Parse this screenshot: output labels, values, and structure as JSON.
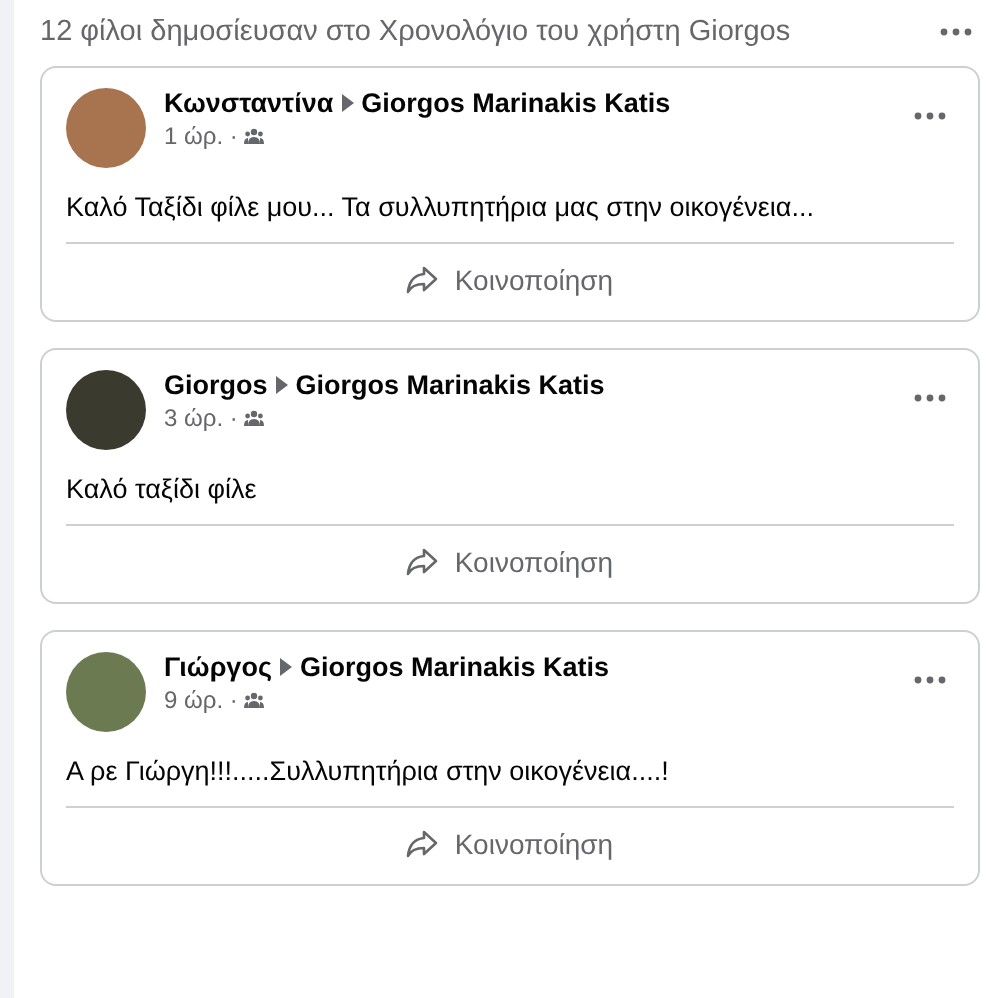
{
  "header": {
    "title": "12 φίλοι δημοσίευσαν στο Χρονολόγιο του χρήστη Giorgos"
  },
  "posts": [
    {
      "author": "Κωνσταντίνα",
      "target": "Giorgos Marinakis Katis",
      "time": "1 ώρ. ·",
      "text": "Καλό Ταξίδι φίλε μου... Τα συλλυπητήρια μας στην οικογένεια...",
      "share": "Κοινοποίηση"
    },
    {
      "author": "Giorgos",
      "target": "Giorgos Marinakis Katis",
      "time": "3 ώρ. ·",
      "text": "Καλό ταξίδι φίλε",
      "share": "Κοινοποίηση"
    },
    {
      "author": "Γιώργος",
      "target": "Giorgos Marinakis Katis",
      "time": "9 ώρ. ·",
      "text": "Α ρε Γιώργη!!!.....Συλλυπητήρια στην οικογένεια....!",
      "share": "Κοινοποίηση"
    }
  ]
}
